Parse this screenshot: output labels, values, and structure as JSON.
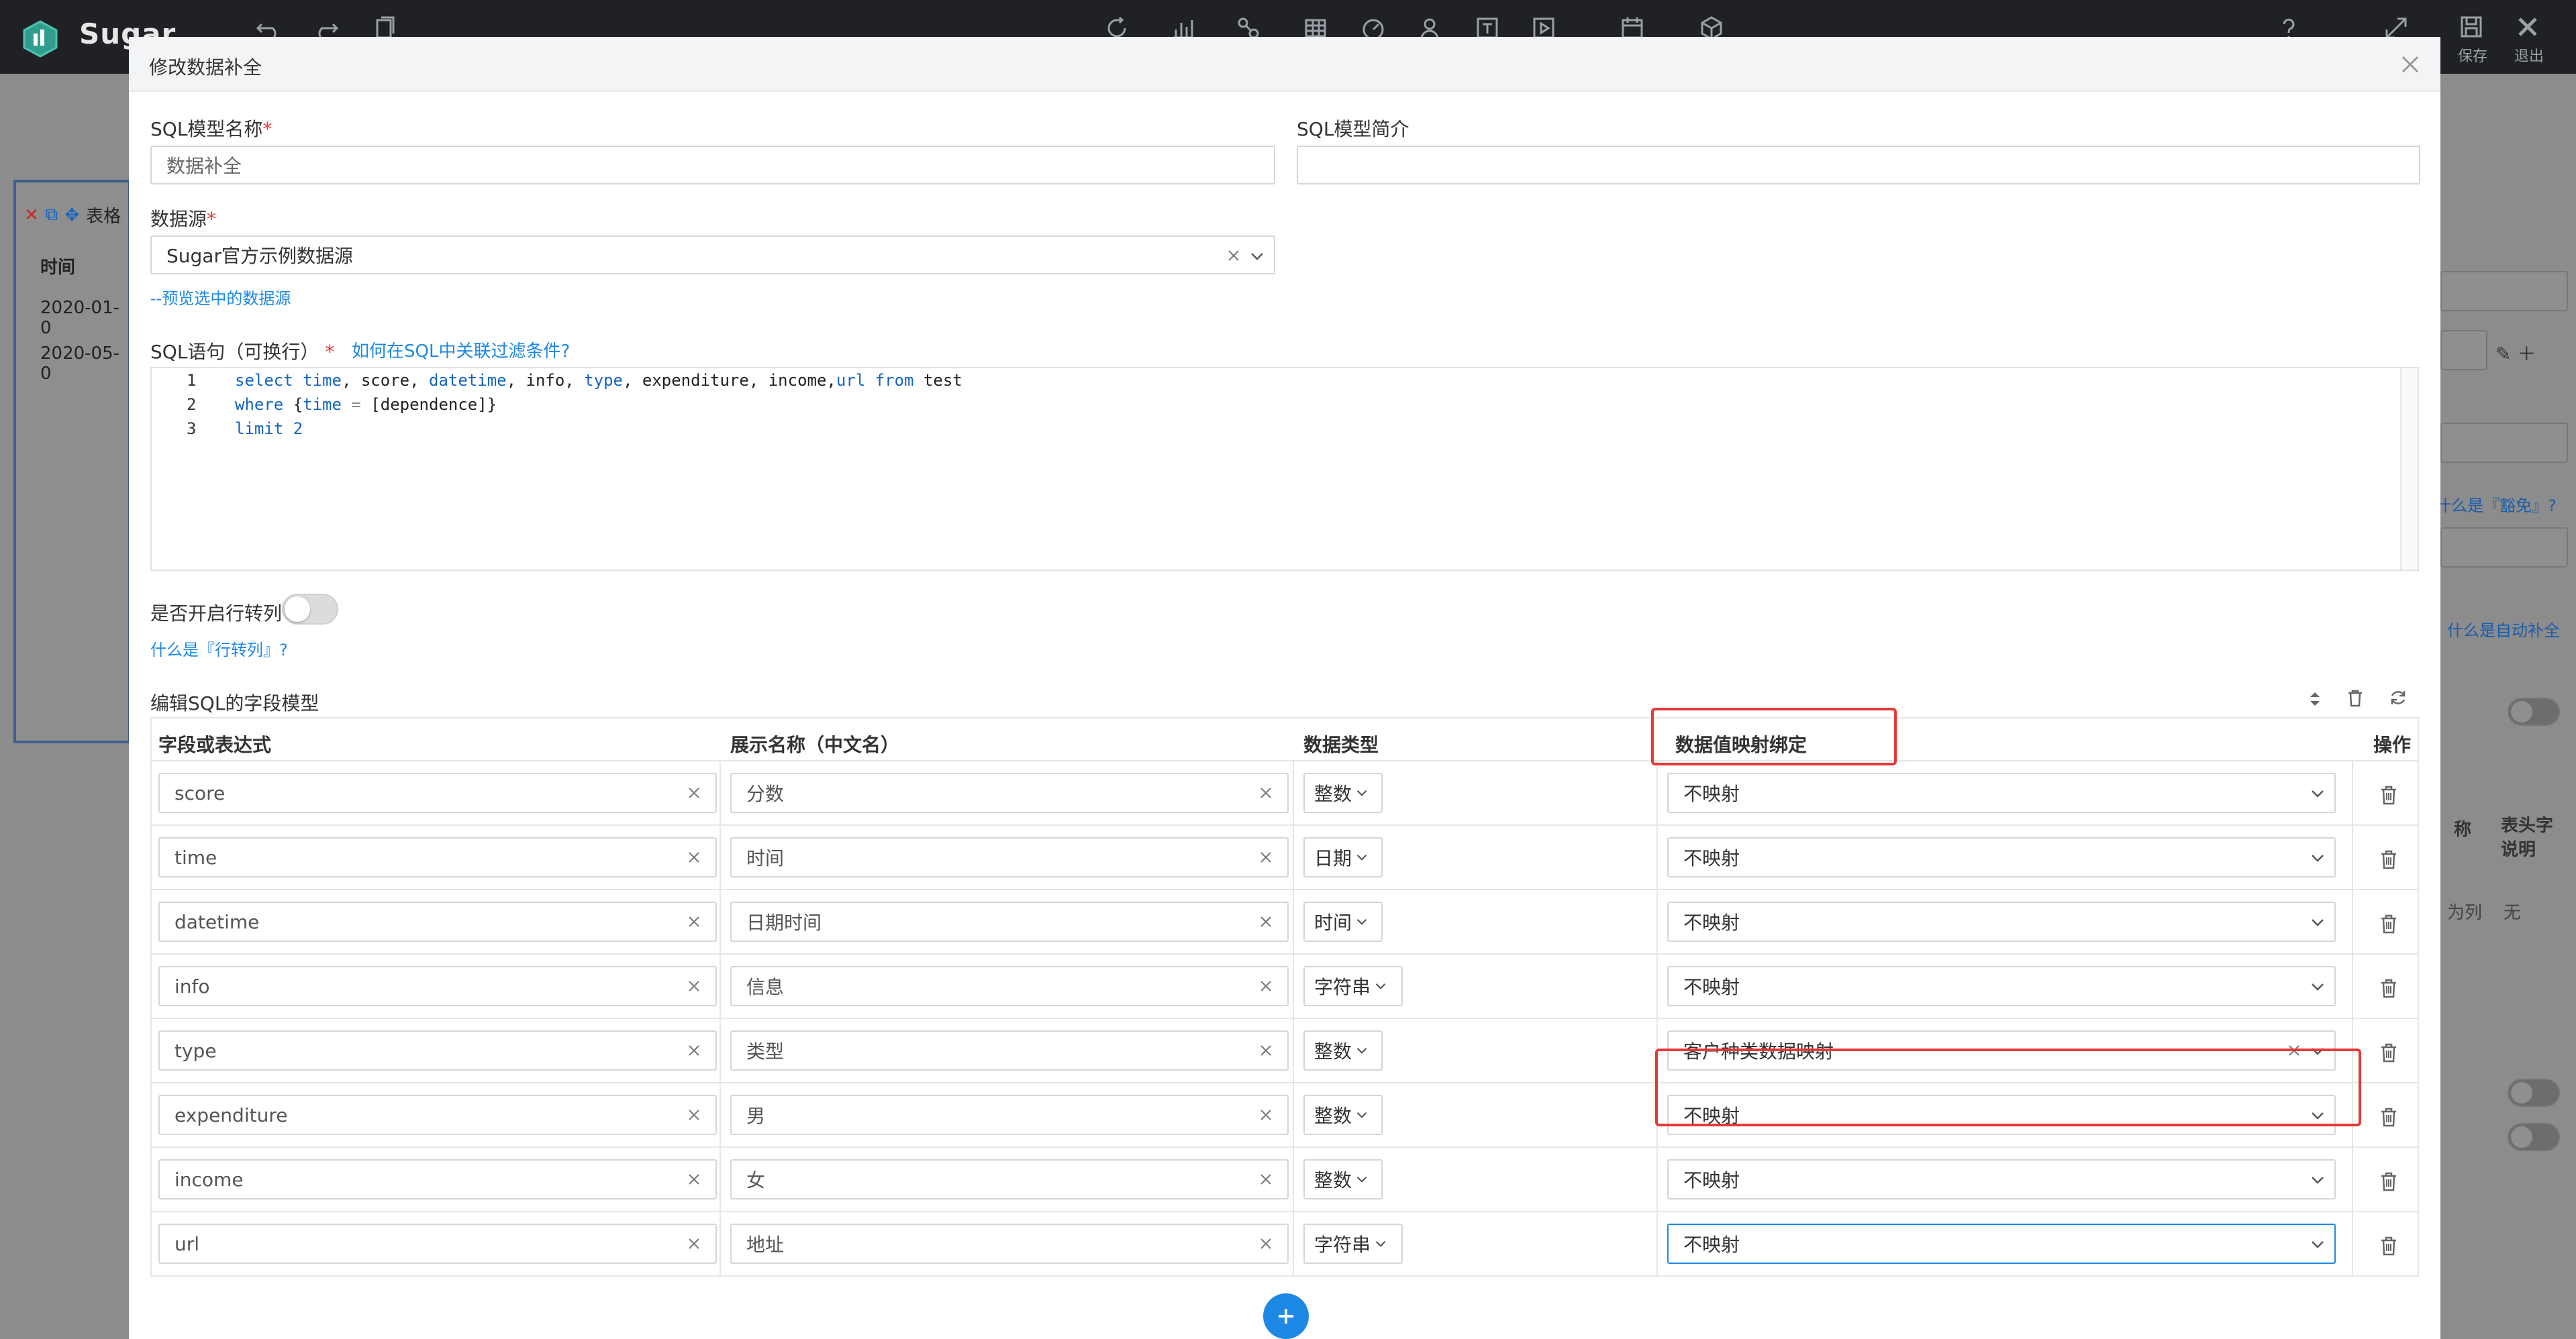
{
  "app": {
    "brand": "Sugar"
  },
  "topbar": {
    "save_label": "保存",
    "exit_label": "退出"
  },
  "background": {
    "panel_title": "表格",
    "column": "时间",
    "rows": [
      "2020-01-0",
      "2020-05-0"
    ],
    "link_douchu": "什么是『豁免』?",
    "link_autofill": "什么是自动补全",
    "col_a": "称",
    "col_b": "表头字",
    "col_b2": "说明",
    "cell_a": "为列",
    "cell_b": "无"
  },
  "modal": {
    "title": "修改数据补全",
    "model_name_label": "SQL模型名称",
    "model_name_value": "数据补全",
    "model_desc_label": "SQL模型简介",
    "model_desc_value": "",
    "datasource_label": "数据源",
    "datasource_value": "Sugar官方示例数据源",
    "preview_link": "--预览选中的数据源",
    "sql_label": "SQL语句（可换行）",
    "sql_help_link": "如何在SQL中关联过滤条件?",
    "sql_lines": [
      "1",
      "2",
      "3"
    ],
    "row_to_col_label": "是否开启行转列",
    "row_to_col_link": "什么是『行转列』?",
    "field_model_label": "编辑SQL的字段模型",
    "table": {
      "headers": {
        "field": "字段或表达式",
        "display": "展示名称（中文名）",
        "dtype": "数据类型",
        "mapping": "数据值映射绑定",
        "action": "操作"
      },
      "rows": [
        {
          "field": "score",
          "display": "分数",
          "dtype": "整数",
          "mapping": "不映射"
        },
        {
          "field": "time",
          "display": "时间",
          "dtype": "日期",
          "mapping": "不映射"
        },
        {
          "field": "datetime",
          "display": "日期时间",
          "dtype": "时间",
          "mapping": "不映射"
        },
        {
          "field": "info",
          "display": "信息",
          "dtype": "字符串",
          "mapping": "不映射"
        },
        {
          "field": "type",
          "display": "类型",
          "dtype": "整数",
          "mapping": "客户种类数据映射"
        },
        {
          "field": "expenditure",
          "display": "男",
          "dtype": "整数",
          "mapping": "不映射"
        },
        {
          "field": "income",
          "display": "女",
          "dtype": "整数",
          "mapping": "不映射"
        },
        {
          "field": "url",
          "display": "地址",
          "dtype": "字符串",
          "mapping": "不映射"
        }
      ]
    }
  },
  "colors": {
    "accent": "#1e88e5",
    "highlight": "#e53935",
    "topbar": "#1f2125"
  }
}
